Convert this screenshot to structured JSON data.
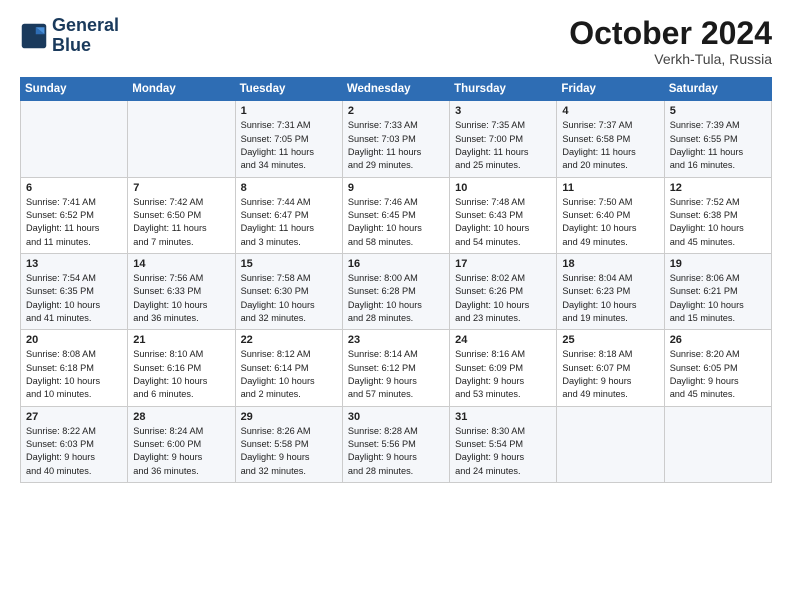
{
  "header": {
    "logo_line1": "General",
    "logo_line2": "Blue",
    "month_title": "October 2024",
    "subtitle": "Verkh-Tula, Russia"
  },
  "days_of_week": [
    "Sunday",
    "Monday",
    "Tuesday",
    "Wednesday",
    "Thursday",
    "Friday",
    "Saturday"
  ],
  "weeks": [
    [
      {
        "num": "",
        "detail": ""
      },
      {
        "num": "",
        "detail": ""
      },
      {
        "num": "1",
        "detail": "Sunrise: 7:31 AM\nSunset: 7:05 PM\nDaylight: 11 hours\nand 34 minutes."
      },
      {
        "num": "2",
        "detail": "Sunrise: 7:33 AM\nSunset: 7:03 PM\nDaylight: 11 hours\nand 29 minutes."
      },
      {
        "num": "3",
        "detail": "Sunrise: 7:35 AM\nSunset: 7:00 PM\nDaylight: 11 hours\nand 25 minutes."
      },
      {
        "num": "4",
        "detail": "Sunrise: 7:37 AM\nSunset: 6:58 PM\nDaylight: 11 hours\nand 20 minutes."
      },
      {
        "num": "5",
        "detail": "Sunrise: 7:39 AM\nSunset: 6:55 PM\nDaylight: 11 hours\nand 16 minutes."
      }
    ],
    [
      {
        "num": "6",
        "detail": "Sunrise: 7:41 AM\nSunset: 6:52 PM\nDaylight: 11 hours\nand 11 minutes."
      },
      {
        "num": "7",
        "detail": "Sunrise: 7:42 AM\nSunset: 6:50 PM\nDaylight: 11 hours\nand 7 minutes."
      },
      {
        "num": "8",
        "detail": "Sunrise: 7:44 AM\nSunset: 6:47 PM\nDaylight: 11 hours\nand 3 minutes."
      },
      {
        "num": "9",
        "detail": "Sunrise: 7:46 AM\nSunset: 6:45 PM\nDaylight: 10 hours\nand 58 minutes."
      },
      {
        "num": "10",
        "detail": "Sunrise: 7:48 AM\nSunset: 6:43 PM\nDaylight: 10 hours\nand 54 minutes."
      },
      {
        "num": "11",
        "detail": "Sunrise: 7:50 AM\nSunset: 6:40 PM\nDaylight: 10 hours\nand 49 minutes."
      },
      {
        "num": "12",
        "detail": "Sunrise: 7:52 AM\nSunset: 6:38 PM\nDaylight: 10 hours\nand 45 minutes."
      }
    ],
    [
      {
        "num": "13",
        "detail": "Sunrise: 7:54 AM\nSunset: 6:35 PM\nDaylight: 10 hours\nand 41 minutes."
      },
      {
        "num": "14",
        "detail": "Sunrise: 7:56 AM\nSunset: 6:33 PM\nDaylight: 10 hours\nand 36 minutes."
      },
      {
        "num": "15",
        "detail": "Sunrise: 7:58 AM\nSunset: 6:30 PM\nDaylight: 10 hours\nand 32 minutes."
      },
      {
        "num": "16",
        "detail": "Sunrise: 8:00 AM\nSunset: 6:28 PM\nDaylight: 10 hours\nand 28 minutes."
      },
      {
        "num": "17",
        "detail": "Sunrise: 8:02 AM\nSunset: 6:26 PM\nDaylight: 10 hours\nand 23 minutes."
      },
      {
        "num": "18",
        "detail": "Sunrise: 8:04 AM\nSunset: 6:23 PM\nDaylight: 10 hours\nand 19 minutes."
      },
      {
        "num": "19",
        "detail": "Sunrise: 8:06 AM\nSunset: 6:21 PM\nDaylight: 10 hours\nand 15 minutes."
      }
    ],
    [
      {
        "num": "20",
        "detail": "Sunrise: 8:08 AM\nSunset: 6:18 PM\nDaylight: 10 hours\nand 10 minutes."
      },
      {
        "num": "21",
        "detail": "Sunrise: 8:10 AM\nSunset: 6:16 PM\nDaylight: 10 hours\nand 6 minutes."
      },
      {
        "num": "22",
        "detail": "Sunrise: 8:12 AM\nSunset: 6:14 PM\nDaylight: 10 hours\nand 2 minutes."
      },
      {
        "num": "23",
        "detail": "Sunrise: 8:14 AM\nSunset: 6:12 PM\nDaylight: 9 hours\nand 57 minutes."
      },
      {
        "num": "24",
        "detail": "Sunrise: 8:16 AM\nSunset: 6:09 PM\nDaylight: 9 hours\nand 53 minutes."
      },
      {
        "num": "25",
        "detail": "Sunrise: 8:18 AM\nSunset: 6:07 PM\nDaylight: 9 hours\nand 49 minutes."
      },
      {
        "num": "26",
        "detail": "Sunrise: 8:20 AM\nSunset: 6:05 PM\nDaylight: 9 hours\nand 45 minutes."
      }
    ],
    [
      {
        "num": "27",
        "detail": "Sunrise: 8:22 AM\nSunset: 6:03 PM\nDaylight: 9 hours\nand 40 minutes."
      },
      {
        "num": "28",
        "detail": "Sunrise: 8:24 AM\nSunset: 6:00 PM\nDaylight: 9 hours\nand 36 minutes."
      },
      {
        "num": "29",
        "detail": "Sunrise: 8:26 AM\nSunset: 5:58 PM\nDaylight: 9 hours\nand 32 minutes."
      },
      {
        "num": "30",
        "detail": "Sunrise: 8:28 AM\nSunset: 5:56 PM\nDaylight: 9 hours\nand 28 minutes."
      },
      {
        "num": "31",
        "detail": "Sunrise: 8:30 AM\nSunset: 5:54 PM\nDaylight: 9 hours\nand 24 minutes."
      },
      {
        "num": "",
        "detail": ""
      },
      {
        "num": "",
        "detail": ""
      }
    ]
  ]
}
